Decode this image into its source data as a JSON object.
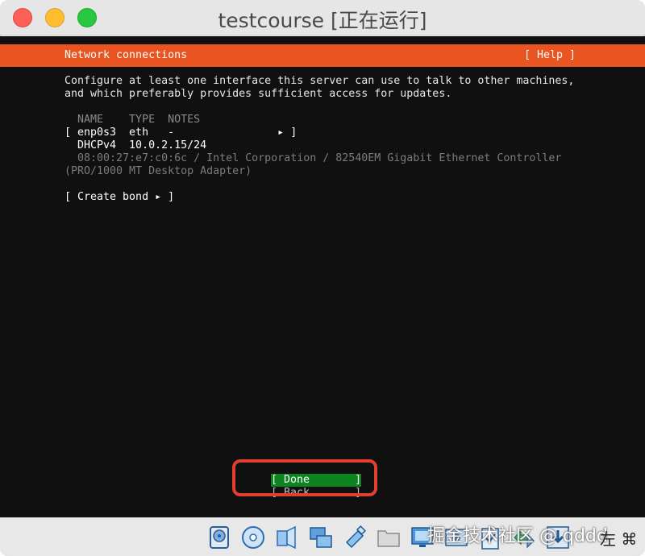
{
  "window": {
    "title": "testcourse [正在运行]"
  },
  "installer": {
    "screen_title": "Network connections",
    "help_button": "[ Help ]",
    "intro_line1": "Configure at least one interface this server can use to talk to other machines,",
    "intro_line2": "and which preferably provides sufficient access for updates.",
    "column_headers": "  NAME    TYPE  NOTES",
    "interface_row": "[ enp0s3  eth   -                ▸ ]",
    "dhcp_row": "  DHCPv4  10.0.2.15/24",
    "mac_row": "  08:00:27:e7:c0:6c / Intel Corporation / 82540EM Gigabit Ethernet Controller",
    "adapter_row": "(PRO/1000 MT Desktop Adapter)",
    "create_bond": "[ Create bond ▸ ]",
    "done_button": "[ Done       ]",
    "back_button": "[ Back       ]"
  },
  "statusbar": {
    "icons": [
      "hard-disk-icon",
      "optical-drive-icon",
      "audio-icon",
      "network-icon",
      "usb-icon",
      "shared-folder-icon",
      "display-icon",
      "recording-icon",
      "clipboard-icon",
      "mouse-integration-icon",
      "download-icon"
    ],
    "host_key": "左 ⌘",
    "watermark": "掘金技术社区 @ qddd"
  },
  "colors": {
    "accent": "#e95420",
    "done_green": "#0e8420",
    "ring_red": "#e53e2f"
  }
}
